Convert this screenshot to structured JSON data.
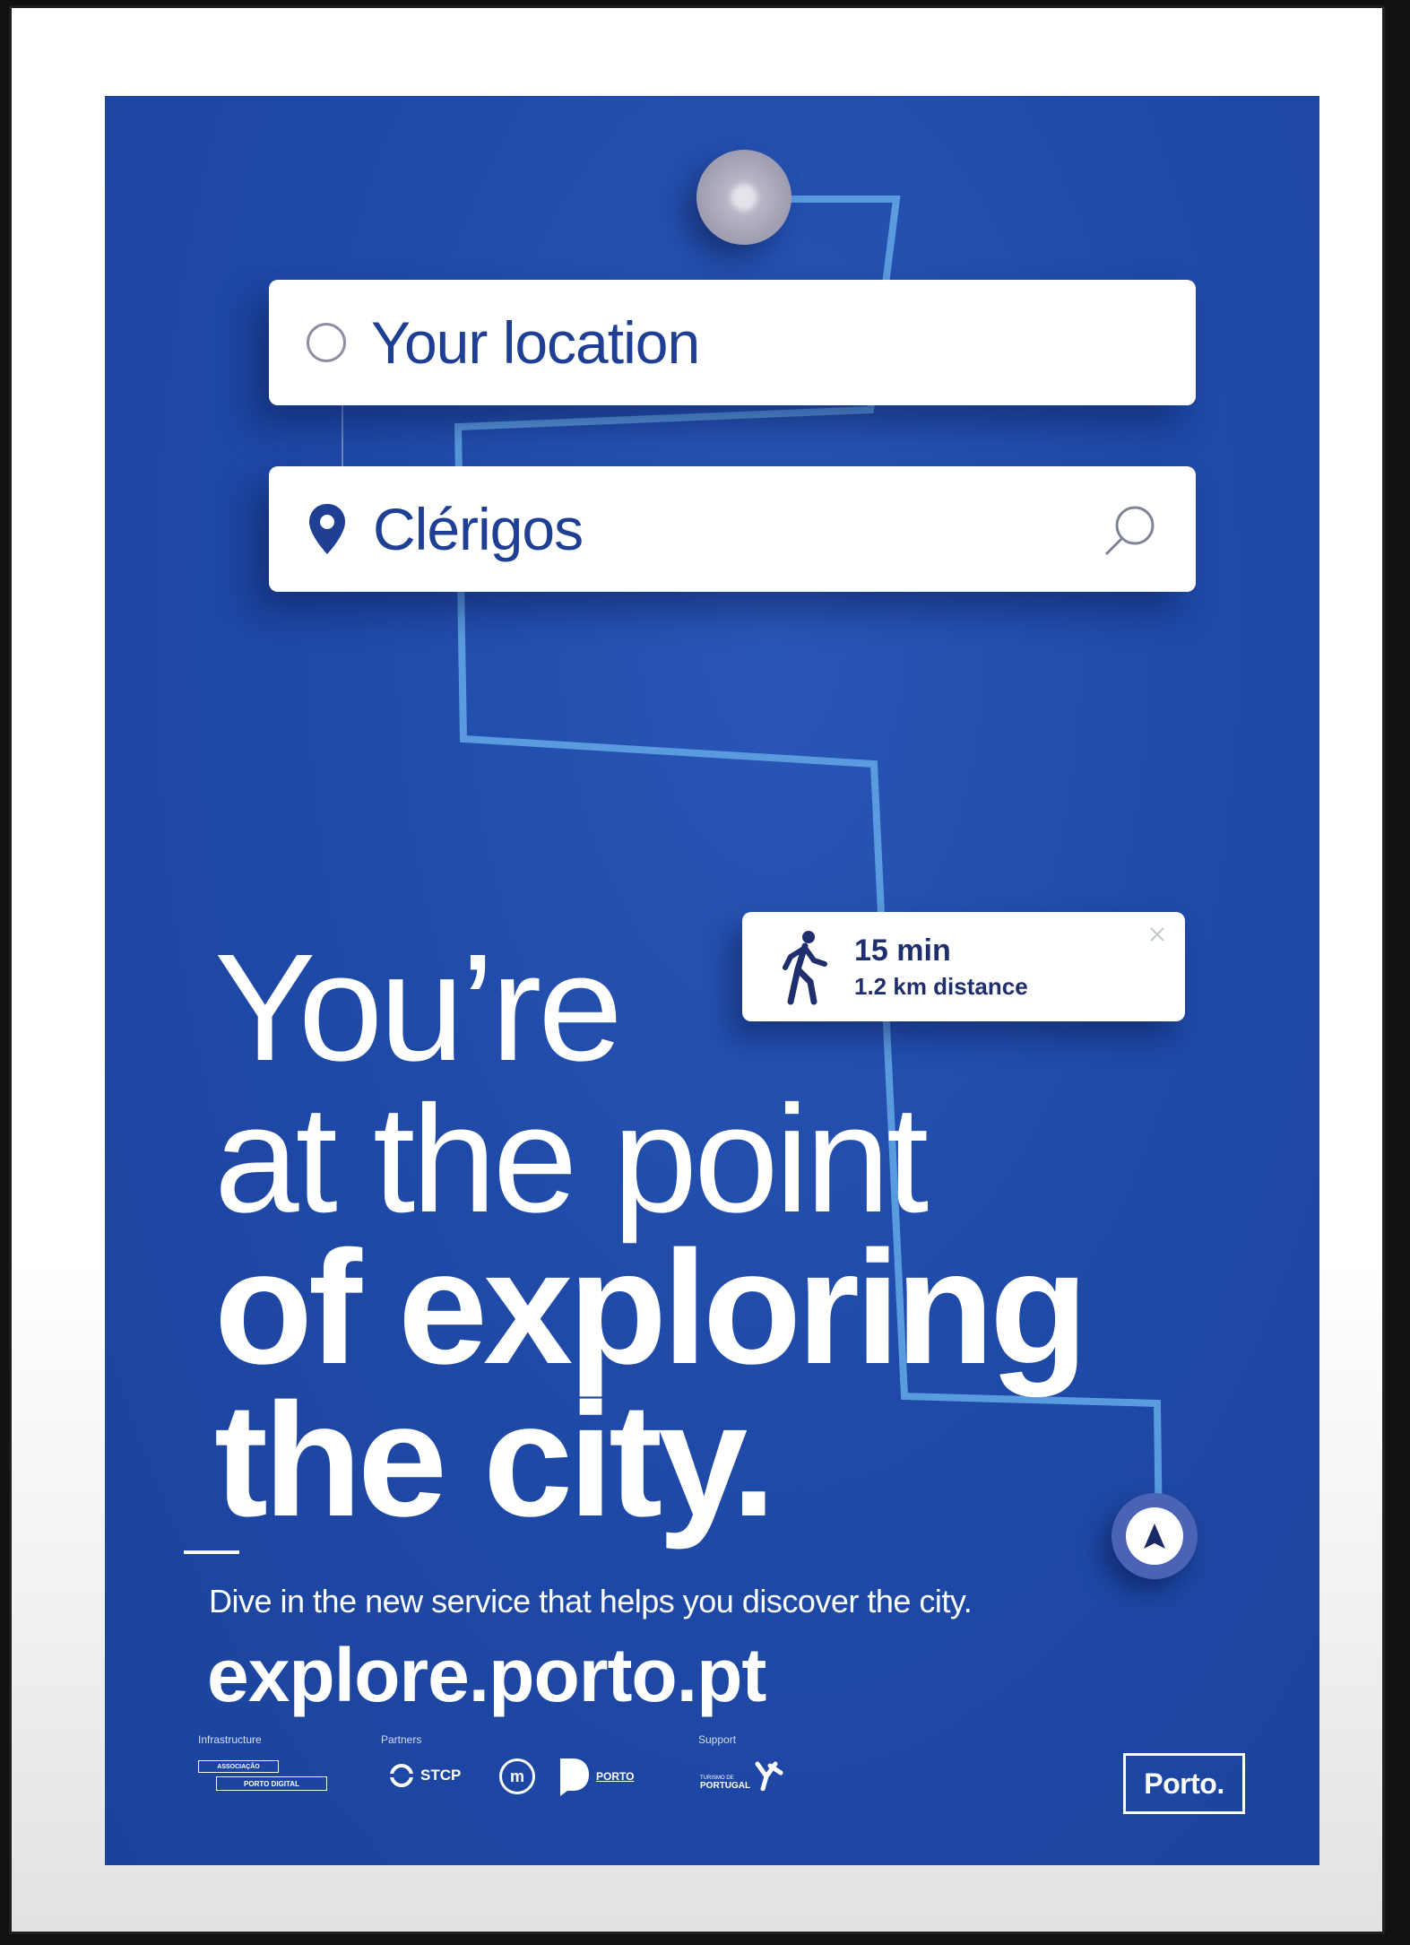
{
  "search": {
    "origin_text": "Your location",
    "destination_text": "Clérigos"
  },
  "walk_card": {
    "time": "15 min",
    "distance": "1.2 km distance"
  },
  "headline": {
    "line1": "You’re",
    "line2": "at the point",
    "line3": "of exploring",
    "line4": "the city."
  },
  "tagline": "Dive in the new service that helps you discover the city.",
  "url": "explore.porto.pt",
  "footer": {
    "infrastructure_label": "Infrastructure",
    "partners_label": "Partners",
    "support_label": "Support",
    "logos": {
      "associacao": "ASSOCIAÇÃO",
      "porto_digital": "PORTO DIGITAL",
      "stcp": "STCP",
      "metro": "m",
      "porto_agency": "PORTO",
      "turismo_small": "TURISMO DE",
      "turismo": "PORTUGAL",
      "porto_city": "Porto."
    }
  },
  "colors": {
    "poster_blue": "#1f4aa8",
    "route_line": "#5a9be0",
    "text_navy": "#1f3f95"
  },
  "icons": {
    "origin": "circle-icon",
    "destination": "location-pin-icon",
    "search": "magnifier-icon",
    "walk": "walking-person-icon",
    "close": "close-icon",
    "navigate": "navigation-arrow-icon"
  }
}
